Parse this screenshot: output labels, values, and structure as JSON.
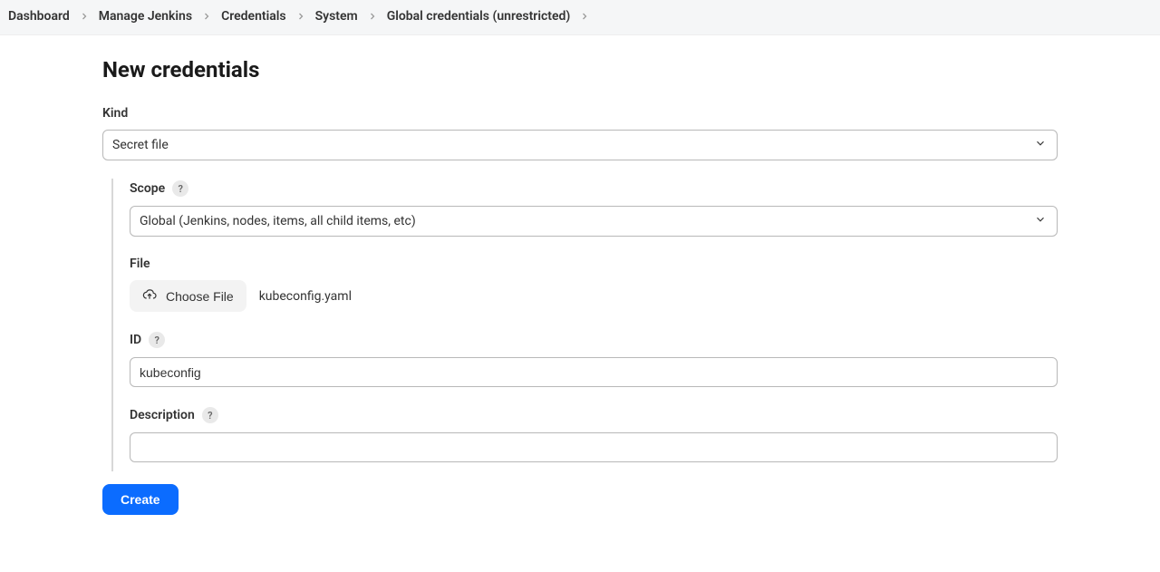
{
  "breadcrumbs": [
    {
      "label": "Dashboard"
    },
    {
      "label": "Manage Jenkins"
    },
    {
      "label": "Credentials"
    },
    {
      "label": "System"
    },
    {
      "label": "Global credentials (unrestricted)"
    }
  ],
  "page": {
    "title": "New credentials"
  },
  "form": {
    "kind": {
      "label": "Kind",
      "value": "Secret file"
    },
    "scope": {
      "label": "Scope",
      "value": "Global (Jenkins, nodes, items, all child items, etc)"
    },
    "file": {
      "label": "File",
      "button_label": "Choose File",
      "filename": "kubeconfig.yaml"
    },
    "id": {
      "label": "ID",
      "value": "kubeconfig"
    },
    "description": {
      "label": "Description",
      "value": ""
    },
    "submit_label": "Create",
    "help_char": "?"
  }
}
